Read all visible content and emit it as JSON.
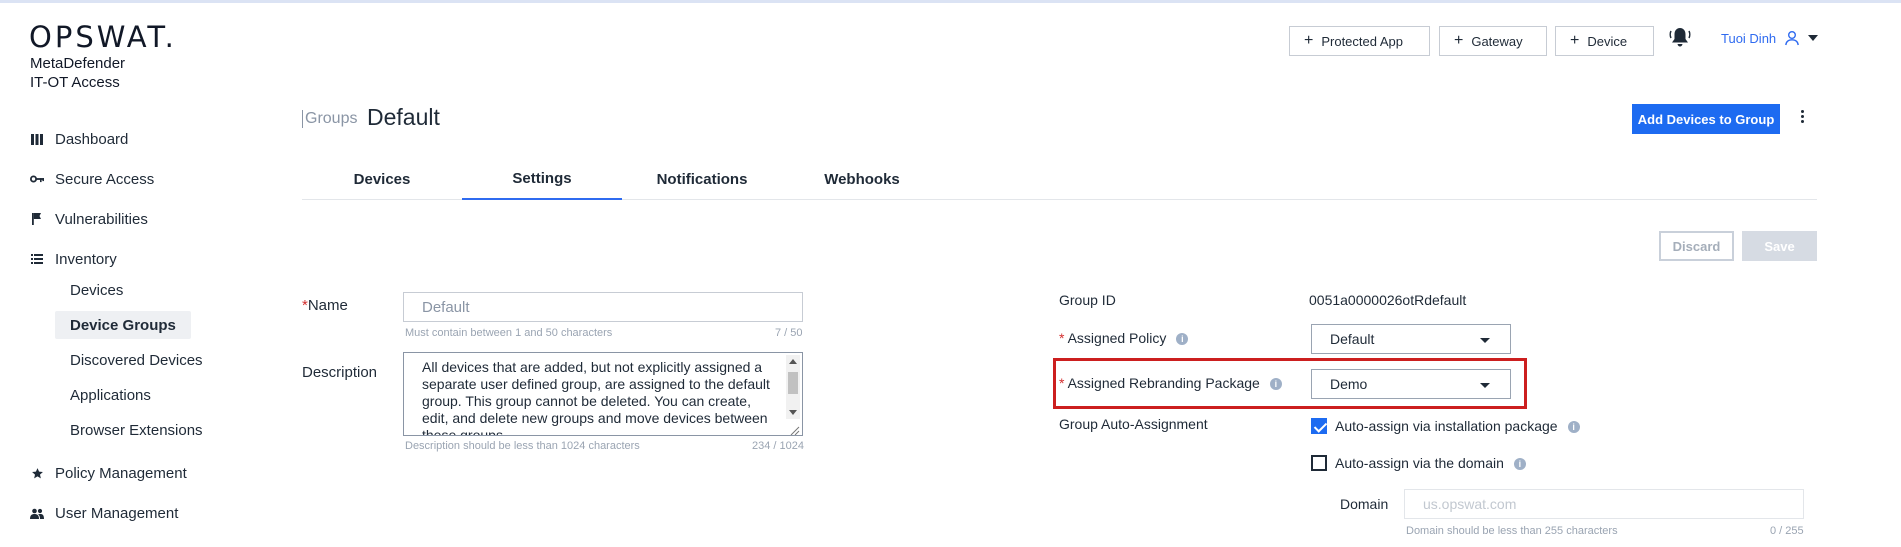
{
  "brand": {
    "logo": "OPSWAT.",
    "product_line1": "MetaDefender",
    "product_line2": "IT-OT Access"
  },
  "sidebar": {
    "items": [
      {
        "label": "Dashboard",
        "icon": "dashboard-icon"
      },
      {
        "label": "Secure Access",
        "icon": "key-icon"
      },
      {
        "label": "Vulnerabilities",
        "icon": "flag-icon"
      },
      {
        "label": "Inventory",
        "icon": "list-icon"
      },
      {
        "label": "Policy Management",
        "icon": "star-icon"
      },
      {
        "label": "User Management",
        "icon": "users-icon"
      }
    ],
    "inventory_children": [
      {
        "label": "Devices"
      },
      {
        "label": "Device Groups",
        "active": true
      },
      {
        "label": "Discovered Devices"
      },
      {
        "label": "Applications"
      },
      {
        "label": "Browser Extensions"
      }
    ]
  },
  "header": {
    "buttons": [
      "Protected App",
      "Gateway",
      "Device"
    ],
    "user_name": "Tuoi Dinh"
  },
  "page": {
    "breadcrumb": "Groups",
    "title": "Default",
    "primary_action": "Add Devices to Group"
  },
  "tabs": [
    {
      "label": "Devices"
    },
    {
      "label": "Settings",
      "active": true
    },
    {
      "label": "Notifications"
    },
    {
      "label": "Webhooks"
    }
  ],
  "actions": {
    "discard": "Discard",
    "save": "Save"
  },
  "form": {
    "name_label": "Name",
    "name_value": "Default",
    "name_hint": "Must contain between 1 and 50 characters",
    "name_count": "7 / 50",
    "description_label": "Description",
    "description_value": "All devices that are added, but not explicitly assigned a separate user defined group, are assigned to the default group. This group cannot be deleted. You can create, edit, and delete new groups and move devices between these groups.",
    "description_hint": "Description should be less than 1024 characters",
    "description_count": "234 / 1024",
    "group_id_label": "Group ID",
    "group_id_value": "0051a0000026otRdefault",
    "assigned_policy_label": "Assigned Policy",
    "assigned_policy_value": "Default",
    "rebranding_label": "Assigned Rebranding Package",
    "rebranding_value": "Demo",
    "auto_assignment_label": "Group Auto-Assignment",
    "auto_install_label": "Auto-assign via installation package",
    "auto_install_checked": true,
    "auto_domain_label": "Auto-assign via the domain",
    "auto_domain_checked": false,
    "domain_label": "Domain",
    "domain_placeholder": "us.opswat.com",
    "domain_hint": "Domain should be less than 255 characters",
    "domain_count": "0 / 255"
  },
  "colors": {
    "accent": "#1d6bf1",
    "highlight": "#cc1f1f",
    "required": "#d32f2f"
  }
}
